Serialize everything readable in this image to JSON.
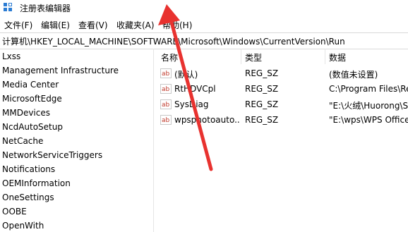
{
  "window": {
    "title": "注册表编辑器",
    "icon": "regedit-icon"
  },
  "menu": [
    {
      "label": "文件(F)"
    },
    {
      "label": "编辑(E)"
    },
    {
      "label": "查看(V)"
    },
    {
      "label": "收藏夹(A)"
    },
    {
      "label": "帮助(H)"
    }
  ],
  "address": {
    "path": "计算机\\HKEY_LOCAL_MACHINE\\SOFTWARE\\Microsoft\\Windows\\CurrentVersion\\Run"
  },
  "tree": {
    "items": [
      {
        "label": "Lxss"
      },
      {
        "label": "Management Infrastructure"
      },
      {
        "label": "Media Center"
      },
      {
        "label": "MicrosoftEdge"
      },
      {
        "label": "MMDevices"
      },
      {
        "label": "NcdAutoSetup"
      },
      {
        "label": "NetCache"
      },
      {
        "label": "NetworkServiceTriggers"
      },
      {
        "label": "Notifications"
      },
      {
        "label": "OEMInformation"
      },
      {
        "label": "OneSettings"
      },
      {
        "label": "OOBE"
      },
      {
        "label": "OpenWith"
      }
    ]
  },
  "list": {
    "columns": {
      "name": "名称",
      "type": "类型",
      "data": "数据"
    },
    "rows": [
      {
        "name": "(默认)",
        "type": "REG_SZ",
        "data": "(数值未设置)",
        "icon": "string-value-icon"
      },
      {
        "name": "RtHDVCpl",
        "type": "REG_SZ",
        "data": "C:\\Program Files\\Re",
        "icon": "string-value-icon"
      },
      {
        "name": "SysDiag",
        "type": "REG_SZ",
        "data": "\"E:\\火绒\\Huorong\\S",
        "icon": "string-value-icon"
      },
      {
        "name": "wpsphotoauto...",
        "type": "REG_SZ",
        "data": "\"E:\\wps\\WPS Office",
        "icon": "string-value-icon"
      }
    ]
  },
  "annotation": {
    "icon": "red-arrow-icon",
    "color": "#e8322f"
  }
}
